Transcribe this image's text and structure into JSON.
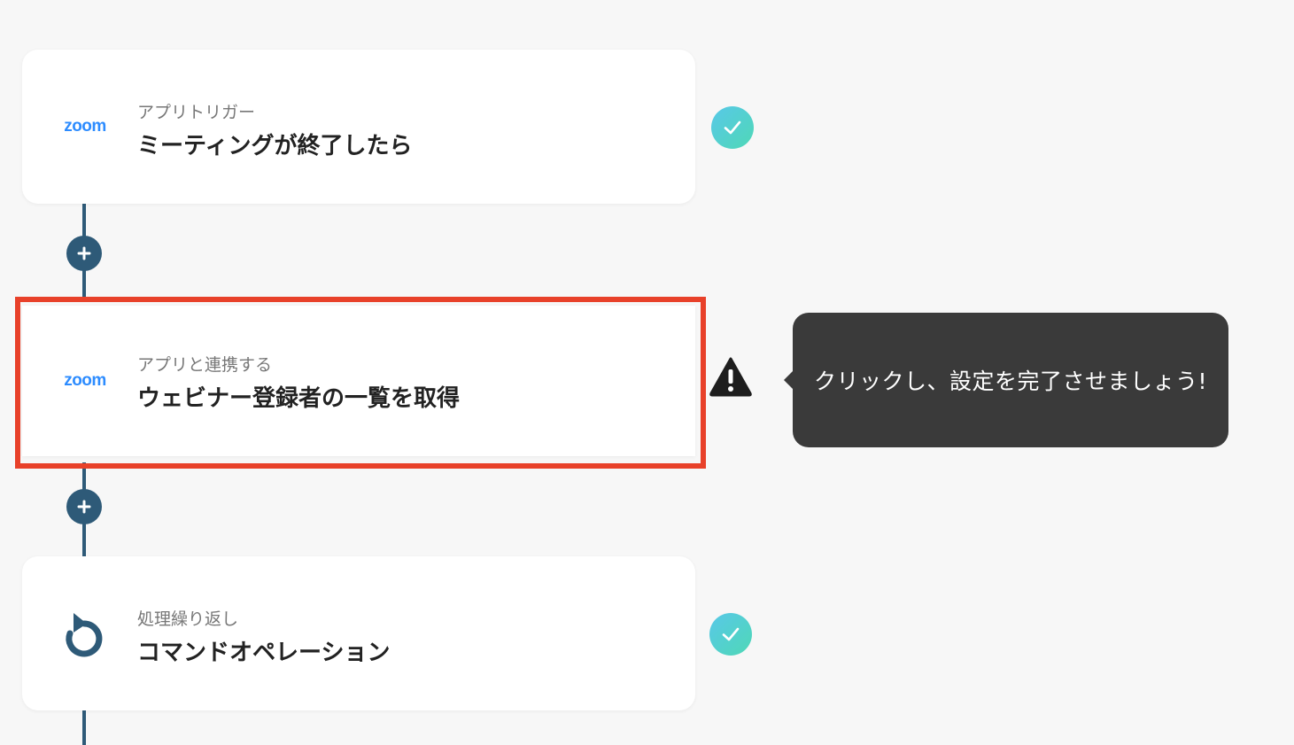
{
  "flow": {
    "steps": [
      {
        "type_label": "アプリトリガー",
        "title": "ミーティングが終了したら",
        "app_logo_text": "zoom",
        "status": "complete"
      },
      {
        "type_label": "アプリと連携する",
        "title": "ウェビナー登録者の一覧を取得",
        "app_logo_text": "zoom",
        "status": "warning"
      },
      {
        "type_label": "処理繰り返し",
        "title": "コマンドオペレーション",
        "icon": "loop-icon",
        "status": "complete"
      }
    ]
  },
  "tooltip": {
    "text": "クリックし、設定を完了させましょう!"
  },
  "colors": {
    "timeline": "#2e5a78",
    "highlight": "#e8412a",
    "zoom_brand": "#2d8cff",
    "check_gradient_start": "#58c8e8",
    "check_gradient_end": "#4fd8b6",
    "tooltip_bg": "#3a3a3a"
  }
}
